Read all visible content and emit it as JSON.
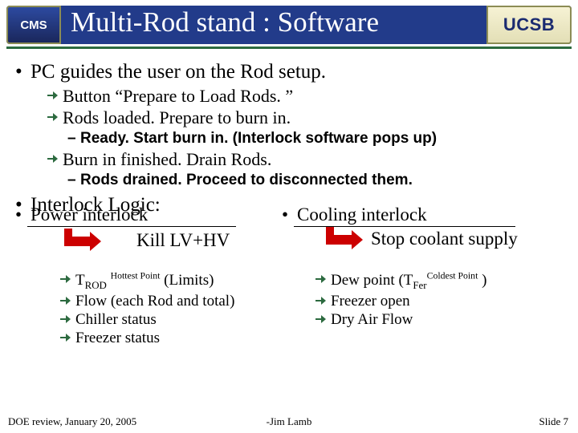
{
  "header": {
    "cms": "CMS",
    "title": "Multi-Rod stand : Software",
    "ucsb": "UCSB"
  },
  "bullets": [
    {
      "text": "PC guides the user on the Rod setup.",
      "children": [
        {
          "text": "Button “Prepare to Load Rods. ”"
        },
        {
          "text": "Rods loaded. Prepare to burn in.",
          "children": [
            {
              "text": "Ready. Start burn in. (Interlock software pops up)"
            }
          ]
        },
        {
          "text": "Burn in finished. Drain Rods.",
          "children": [
            {
              "text": "Rods drained. Proceed to disconnected them."
            }
          ]
        }
      ]
    },
    {
      "text": "Interlock Logic:"
    }
  ],
  "cols": {
    "left": {
      "head": "Power interlock",
      "action": "Kill LV+HV",
      "items": [
        {
          "sub": "ROD",
          "sup": "Hottest Point",
          "tail": "(Limits)"
        },
        {
          "text": "Flow (each Rod and total)"
        },
        {
          "text": "Chiller status"
        },
        {
          "text": "Freezer status"
        }
      ]
    },
    "right": {
      "head": "Cooling interlock",
      "action": "Stop coolant supply",
      "items": [
        {
          "pre": "Dew point",
          "sub": "Fer",
          "sup": "Coldest Point"
        },
        {
          "text": "Freezer open"
        },
        {
          "text": "Dry Air Flow"
        }
      ]
    }
  },
  "footer": {
    "left": "DOE review, January 20, 2005",
    "center": "-Jim Lamb",
    "right": "Slide 7"
  }
}
